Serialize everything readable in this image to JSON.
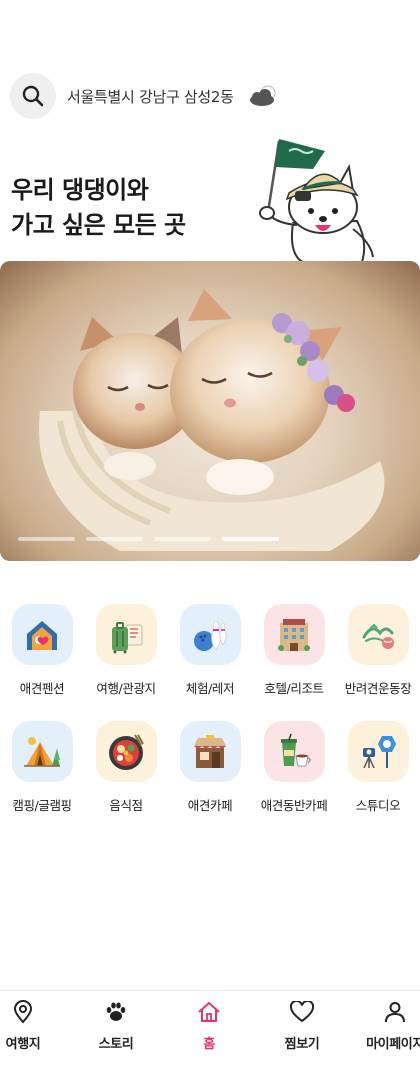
{
  "search": {
    "location": "서울특별시 강남구 삼성2동"
  },
  "headline": {
    "line1": "우리 댕댕이와",
    "line2": "가고 싶은 모든 곳"
  },
  "banner": {
    "slides_total": 4,
    "active_slide": 4
  },
  "categories": [
    {
      "label": "애견펜션",
      "icon": "pension-icon",
      "bg": "#e3f0fb"
    },
    {
      "label": "여행/관광지",
      "icon": "luggage-icon",
      "bg": "#fdf1dc"
    },
    {
      "label": "체험/레저",
      "icon": "bowling-icon",
      "bg": "#e3f0fb"
    },
    {
      "label": "호텔/리조트",
      "icon": "hotel-icon",
      "bg": "#fce3e6"
    },
    {
      "label": "반려견운동장",
      "icon": "dog-playground-icon",
      "bg": "#fdf1dc"
    },
    {
      "label": "캠핑/글램핑",
      "icon": "tent-icon",
      "bg": "#e3f0fb"
    },
    {
      "label": "음식점",
      "icon": "food-bowl-icon",
      "bg": "#fdf1dc"
    },
    {
      "label": "애견카페",
      "icon": "cafe-shop-icon",
      "bg": "#e3f0fb"
    },
    {
      "label": "애견동반카페",
      "icon": "coffee-cup-icon",
      "bg": "#fce3e6"
    },
    {
      "label": "스튜디오",
      "icon": "camera-studio-icon",
      "bg": "#fdf1dc"
    }
  ],
  "nav": [
    {
      "label": "여행지",
      "icon": "location-pin-icon"
    },
    {
      "label": "스토리",
      "icon": "paw-icon"
    },
    {
      "label": "홈",
      "icon": "home-icon",
      "active": true
    },
    {
      "label": "찜보기",
      "icon": "heart-icon"
    },
    {
      "label": "마이페이지",
      "icon": "user-icon"
    }
  ],
  "colors": {
    "accent": "#e8336e",
    "text": "#222222"
  }
}
